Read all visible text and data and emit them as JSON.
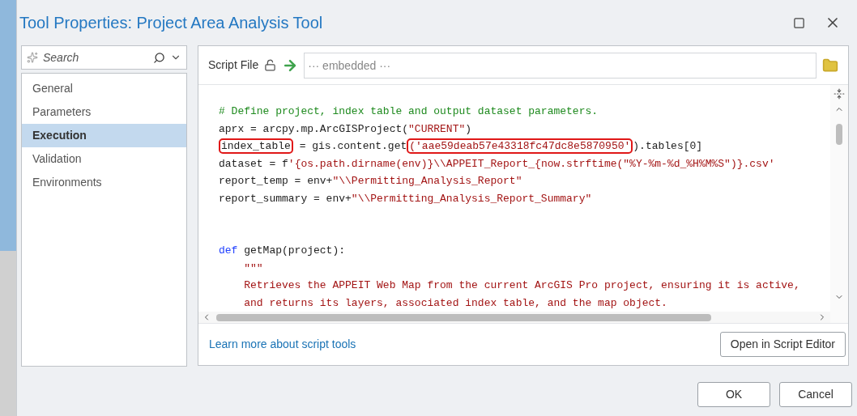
{
  "window": {
    "title": "Tool Properties: Project Area Analysis Tool"
  },
  "search": {
    "placeholder": "Search"
  },
  "nav_items": [
    {
      "label": "General",
      "selected": false
    },
    {
      "label": "Parameters",
      "selected": false
    },
    {
      "label": "Execution",
      "selected": true
    },
    {
      "label": "Validation",
      "selected": false
    },
    {
      "label": "Environments",
      "selected": false
    }
  ],
  "script_file": {
    "label": "Script File",
    "placeholder": "··· embedded ···"
  },
  "code_lines": [
    {
      "kind": "code",
      "segments": [
        {
          "text": "# Define project, index table and output dataset parameters.",
          "kind": "comment",
          "highlighted": false
        }
      ]
    },
    {
      "kind": "code",
      "segments": [
        {
          "text": "aprx = arcpy.mp.ArcGISProject(",
          "kind": "plain",
          "highlighted": false
        },
        {
          "text": "\"CURRENT\"",
          "kind": "string",
          "highlighted": false
        },
        {
          "text": ")",
          "kind": "plain",
          "highlighted": false
        }
      ]
    },
    {
      "kind": "code",
      "segments": [
        {
          "text": "index_table",
          "kind": "plain",
          "highlighted": true
        },
        {
          "text": " = gis.content.get",
          "kind": "plain",
          "highlighted": false
        },
        {
          "text": "('aae59deab57e43318fc47dc8e5870950'",
          "kind": "string",
          "highlighted": true
        },
        {
          "text": ").tables[0]",
          "kind": "plain",
          "highlighted": false
        }
      ]
    },
    {
      "kind": "code",
      "segments": [
        {
          "text": "dataset = f",
          "kind": "plain",
          "highlighted": false
        },
        {
          "text": "'{os.path.dirname(env)}\\\\APPEIT_Report_{now.strftime(\"%Y-%m-%d_%H%M%S\")}.csv'",
          "kind": "string",
          "highlighted": false
        }
      ]
    },
    {
      "kind": "code",
      "segments": [
        {
          "text": "report_temp = env+",
          "kind": "plain",
          "highlighted": false
        },
        {
          "text": "\"\\\\Permitting_Analysis_Report\"",
          "kind": "string",
          "highlighted": false
        }
      ]
    },
    {
      "kind": "code",
      "segments": [
        {
          "text": "report_summary = env+",
          "kind": "plain",
          "highlighted": false
        },
        {
          "text": "\"\\\\Permitting_Analysis_Report_Summary\"",
          "kind": "string",
          "highlighted": false
        }
      ]
    },
    {
      "kind": "blank"
    },
    {
      "kind": "blank"
    },
    {
      "kind": "code",
      "segments": [
        {
          "text": "def",
          "kind": "keyword",
          "highlighted": false
        },
        {
          "text": " getMap(project):",
          "kind": "plain",
          "highlighted": false
        }
      ]
    },
    {
      "kind": "code",
      "segments": [
        {
          "text": "    \"\"\"",
          "kind": "string",
          "highlighted": false
        }
      ]
    },
    {
      "kind": "code",
      "segments": [
        {
          "text": "    Retrieves the APPEIT Web Map from the current ArcGIS Pro project, ensuring it is active,",
          "kind": "string",
          "highlighted": false
        }
      ]
    },
    {
      "kind": "code",
      "segments": [
        {
          "text": "    and returns its layers, associated index table, and the map object.",
          "kind": "string",
          "highlighted": false
        }
      ]
    }
  ],
  "learn_more_link": "Learn more about script tools",
  "open_editor_button": "Open in Script Editor",
  "buttons": [
    "OK",
    "Cancel"
  ]
}
